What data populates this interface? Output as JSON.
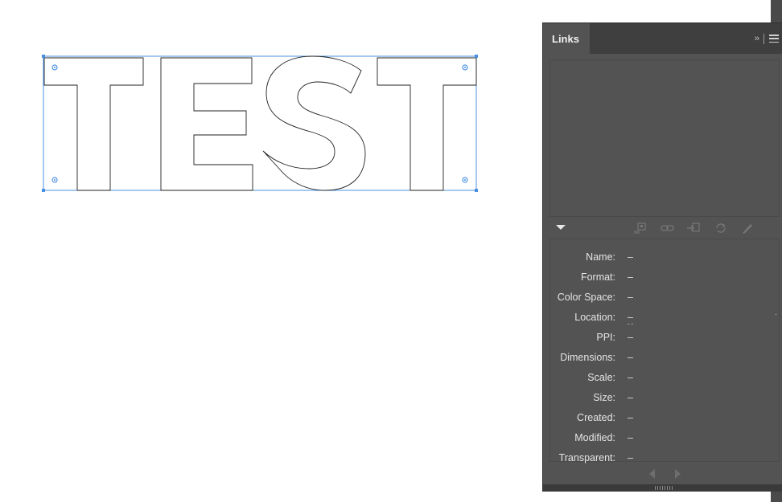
{
  "artwork": {
    "text": "TEST",
    "selection_color": "#4a90e2",
    "outline_color": "#222222"
  },
  "panel": {
    "tab_label": "Links",
    "collapse_glyph": "›› ",
    "menu_icon": "hamburger-menu-icon",
    "toolbar_icons": [
      "relink-from-cc-libraries-icon",
      "relink-icon",
      "go-to-link-icon",
      "update-link-icon",
      "edit-original-icon"
    ],
    "info_rows": [
      {
        "label": "Name:",
        "value": "–"
      },
      {
        "label": "Format:",
        "value": "–"
      },
      {
        "label": "Color Space:",
        "value": "–"
      },
      {
        "label": "Location:",
        "value": "–"
      },
      {
        "label": "PPI:",
        "value": "–"
      },
      {
        "label": "Dimensions:",
        "value": "–"
      },
      {
        "label": "Scale:",
        "value": "–"
      },
      {
        "label": "Size:",
        "value": "–"
      },
      {
        "label": "Created:",
        "value": "–"
      },
      {
        "label": "Modified:",
        "value": "–"
      },
      {
        "label": "Transparent:",
        "value": "–"
      }
    ]
  }
}
